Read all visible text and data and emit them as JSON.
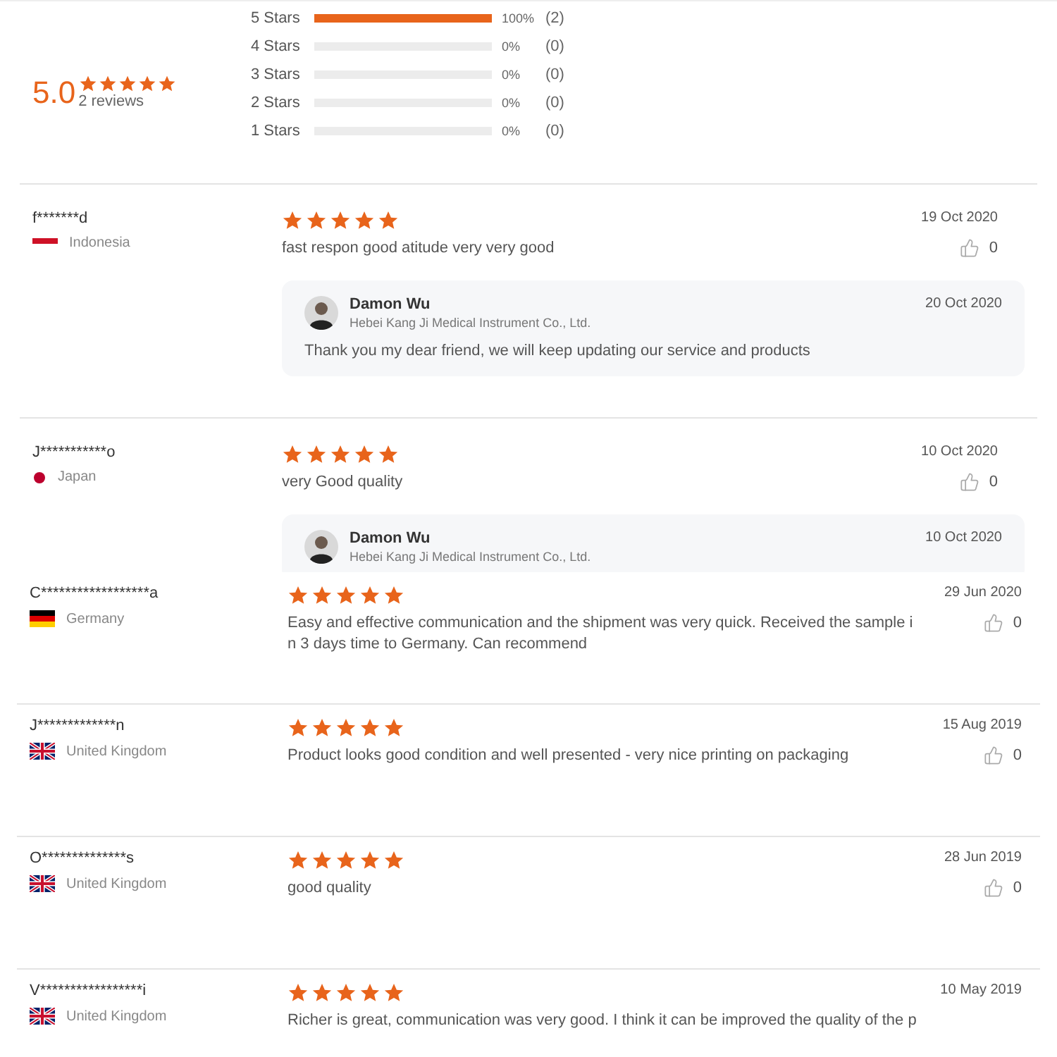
{
  "summary": {
    "score": "5.0",
    "stars": 5,
    "count": "2 reviews",
    "distribution": [
      {
        "label": "5 Stars",
        "level": 1,
        "percent": "100%",
        "count": "(2)"
      },
      {
        "label": "4 Stars",
        "level": 0,
        "percent": "0%",
        "count": "(0)"
      },
      {
        "label": "3 Stars",
        "level": 0,
        "percent": "0%",
        "count": "(0)"
      },
      {
        "label": "2 Stars",
        "level": 0,
        "percent": "0%",
        "count": "(0)"
      },
      {
        "label": "1 Stars",
        "level": 0,
        "percent": "0%",
        "count": "(0)"
      }
    ]
  },
  "reviews": [
    {
      "name": "f*******d",
      "flag": {
        "kind": "indonesia"
      },
      "country": "Indonesia",
      "stars": 5,
      "date": "19 Oct 2020",
      "text": "fast respon good atitude very very good",
      "likes": "0",
      "reply": {
        "name": "Damon Wu",
        "company": "Hebei Kang Ji Medical Instrument Co., Ltd.",
        "date": "20 Oct 2020",
        "text": "Thank you my dear friend, we will keep updating our service and products"
      }
    },
    {
      "name": "J***********o",
      "flag": {
        "kind": "japan"
      },
      "country": "Japan",
      "stars": 5,
      "date": "10 Oct 2020",
      "text": "very Good quality",
      "likes": "0",
      "reply": {
        "name": "Damon Wu",
        "company": "Hebei Kang Ji Medical Instrument Co., Ltd.",
        "date": "10 Oct 2020"
      }
    }
  ],
  "more_reviews": [
    {
      "name": "C******************a",
      "flag": {
        "kind": "germany"
      },
      "country": "Germany",
      "stars": 5,
      "date": "29 Jun 2020",
      "text": "Easy and effective communication and the shipment was very quick. Received the sample in 3 days time to Germany. Can recommend",
      "likes": "0"
    },
    {
      "name": "J*************n",
      "flag": {
        "kind": "uk"
      },
      "country": "United Kingdom",
      "stars": 5,
      "date": "15 Aug 2019",
      "text": "Product looks good condition and well presented - very nice printing on packaging",
      "likes": "0"
    },
    {
      "name": "O**************s",
      "flag": {
        "kind": "uk"
      },
      "country": "United Kingdom",
      "stars": 5,
      "date": "28 Jun 2019",
      "text": "good quality",
      "likes": "0"
    },
    {
      "name": "V*****************i",
      "flag": {
        "kind": "uk"
      },
      "country": "United Kingdom",
      "stars": 5,
      "date": "10 May 2019",
      "text": "Richer is great, communication was very good. I think it can be improved the quality of the p"
    }
  ]
}
